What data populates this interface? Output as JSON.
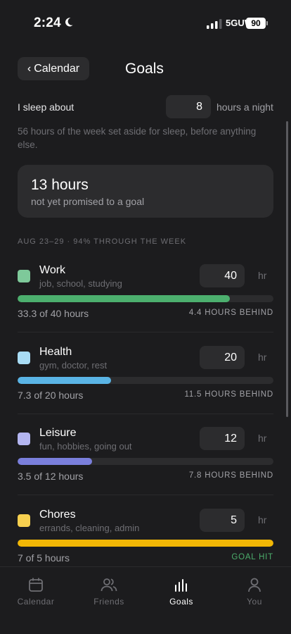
{
  "status_bar": {
    "time": "2:24",
    "network": "5GUW",
    "battery": "90"
  },
  "header": {
    "back_label": "Calendar",
    "title": "Goals"
  },
  "sleep": {
    "label": "I sleep about",
    "value": "8",
    "unit": "hours a night",
    "note": "56 hours of the week set aside for sleep, before anything else."
  },
  "unallocated": {
    "hours": "13 hours",
    "note": "not yet promised to a goal"
  },
  "week_label": "AUG 23–29 · 94% THROUGH THE WEEK",
  "goals": [
    {
      "name": "Work",
      "subtitle": "job, school, studying",
      "target": "40",
      "unit": "hr",
      "progress_text": "33.3 of 40 hours",
      "status": "4.4 HOURS BEHIND",
      "fraction": 0.83,
      "color": "#4caf6e",
      "swatch": "#7ec99a"
    },
    {
      "name": "Health",
      "subtitle": "gym, doctor, rest",
      "target": "20",
      "unit": "hr",
      "progress_text": "7.3 of 20 hours",
      "status": "11.5 HOURS BEHIND",
      "fraction": 0.365,
      "color": "#5ab4e5",
      "swatch": "#a8dcf5"
    },
    {
      "name": "Leisure",
      "subtitle": "fun, hobbies, going out",
      "target": "12",
      "unit": "hr",
      "progress_text": "3.5 of 12 hours",
      "status": "7.8 HOURS BEHIND",
      "fraction": 0.29,
      "color": "#7a7fdc",
      "swatch": "#b3b5f0"
    },
    {
      "name": "Chores",
      "subtitle": "errands, cleaning, admin",
      "target": "5",
      "unit": "hr",
      "progress_text": "7 of 5 hours",
      "status": "GOAL HIT",
      "fraction": 1.0,
      "color": "#f2b705",
      "swatch": "#f7d04f"
    }
  ],
  "tabs": [
    {
      "label": "Calendar",
      "icon": "calendar-icon",
      "active": false
    },
    {
      "label": "Friends",
      "icon": "friends-icon",
      "active": false
    },
    {
      "label": "Goals",
      "icon": "bar-chart-icon",
      "active": true
    },
    {
      "label": "You",
      "icon": "person-icon",
      "active": false
    }
  ]
}
